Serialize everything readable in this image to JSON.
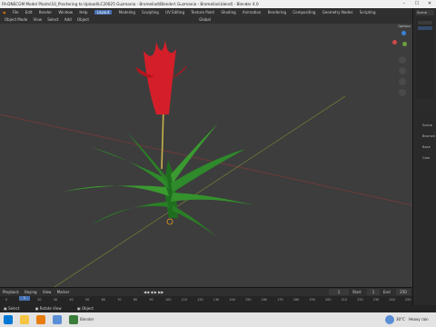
{
  "window": {
    "title": "FA-DNECGM Model Plants\\10_Proctoring to Upload\\LC20025 Guzmania - Bromeliad\\Blender\\ Guzmania - Bromeliad.blend] - Blender 4.0",
    "controls": [
      "–",
      "☐",
      "✕"
    ]
  },
  "menu": {
    "items": [
      "File",
      "Edit",
      "Render",
      "Window",
      "Help"
    ],
    "workspace_tabs": [
      "Layout",
      "Modeling",
      "Sculpting",
      "UV Editing",
      "Texture Paint",
      "Shading",
      "Animation",
      "Rendering",
      "Compositing",
      "Geometry Nodes",
      "Scripting"
    ],
    "active_tab": "Layout",
    "scene_label": "Scene"
  },
  "viewport_header": {
    "items": [
      "Object Mode",
      "View",
      "Select",
      "Add",
      "Object",
      "Global"
    ],
    "options": "Options"
  },
  "sidebar": {
    "labels": [
      "Scene",
      "Bromeli",
      "Back",
      "Cam"
    ]
  },
  "timeline": {
    "menu": [
      "Playback",
      "Keying",
      "View",
      "Marker"
    ],
    "current_frame": "1",
    "start": "Start",
    "start_value": "1",
    "end": "End",
    "end_value": "250",
    "ticks": [
      "0",
      "10",
      "20",
      "30",
      "40",
      "50",
      "60",
      "70",
      "80",
      "90",
      "100",
      "110",
      "120",
      "130",
      "140",
      "150",
      "160",
      "170",
      "180",
      "190",
      "200",
      "210",
      "220",
      "230",
      "240",
      "250"
    ]
  },
  "status": {
    "left": "Select",
    "middle": "Rotate View",
    "right": "Object"
  },
  "taskbar": {
    "weather_temp": "30°C",
    "weather_text": "Heavy rain",
    "active_app": "Blender"
  },
  "colors": {
    "accent": "#4772b3",
    "grid_x": "#7a3a3a",
    "grid_y": "#6b7a35",
    "leaf": "#2e8a2a",
    "flower": "#d41f2a"
  }
}
